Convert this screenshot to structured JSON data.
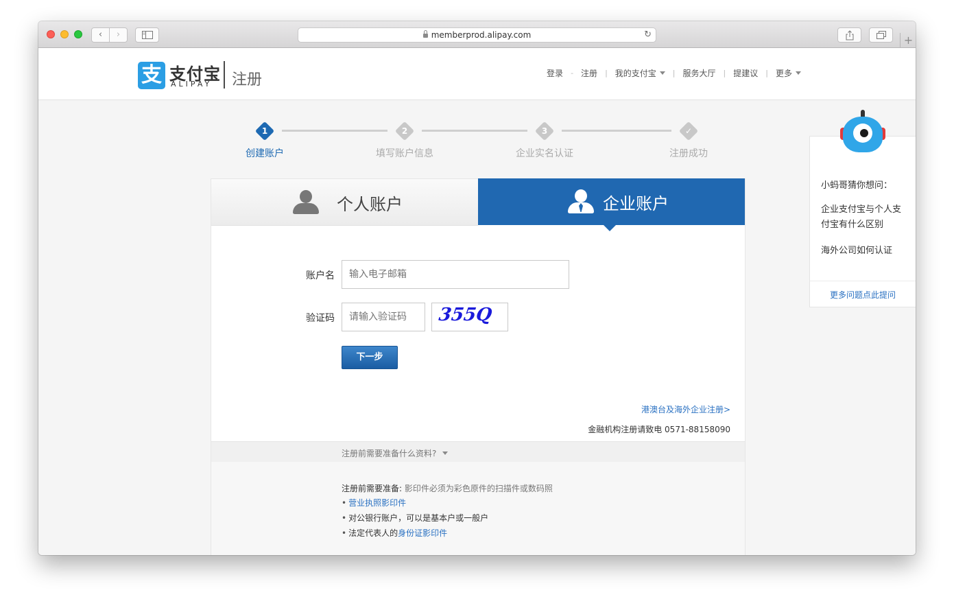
{
  "browser": {
    "url": "memberprod.alipay.com",
    "back_glyph": "‹",
    "forward_glyph": "›",
    "reload_glyph": "↻",
    "new_tab_glyph": "+"
  },
  "header": {
    "logo_cn": "支付宝",
    "logo_en": "ALIPAY",
    "logo_glyph": "支",
    "section": "注册",
    "nav": {
      "login": "登录",
      "register": "注册",
      "my_alipay": "我的支付宝",
      "service_hall": "服务大厅",
      "suggestions": "提建议",
      "more": "更多",
      "sep_dash": "-",
      "sep_bar": "|"
    }
  },
  "steps": [
    {
      "num": "1",
      "label": "创建账户",
      "active": true
    },
    {
      "num": "2",
      "label": "填写账户信息",
      "active": false
    },
    {
      "num": "3",
      "label": "企业实名认证",
      "active": false
    },
    {
      "num": "✓",
      "label": "注册成功",
      "active": false
    }
  ],
  "tabs": {
    "personal": "个人账户",
    "company": "企业账户"
  },
  "form": {
    "account_label": "账户名",
    "account_placeholder": "输入电子邮箱",
    "captcha_label": "验证码",
    "captcha_placeholder": "请输入验证码",
    "captcha_text": "355Q",
    "next_button": "下一步",
    "overseas_link": "港澳台及海外企业注册>",
    "hotline": "金融机构注册请致电 0571-88158090"
  },
  "prep": {
    "toggle": "注册前需要准备什么资料?",
    "title": "注册前需要准备:",
    "note": "影印件必须为彩色原件的扫描件或数码照",
    "items": {
      "license": "营业执照影印件",
      "bank": "对公银行账户，可以是基本户或一般户",
      "legal_prefix": "法定代表人的",
      "legal_link": "身份证影印件"
    }
  },
  "help": {
    "title": "小蚂哥猜你想问：",
    "q1": "企业支付宝与个人支付宝有什么区别",
    "q2": "海外公司如何认证",
    "more": "更多问题点此提问"
  },
  "colors": {
    "brand_blue": "#2068b1",
    "link_blue": "#2a71c2",
    "logo_blue": "#2b9ee4"
  }
}
